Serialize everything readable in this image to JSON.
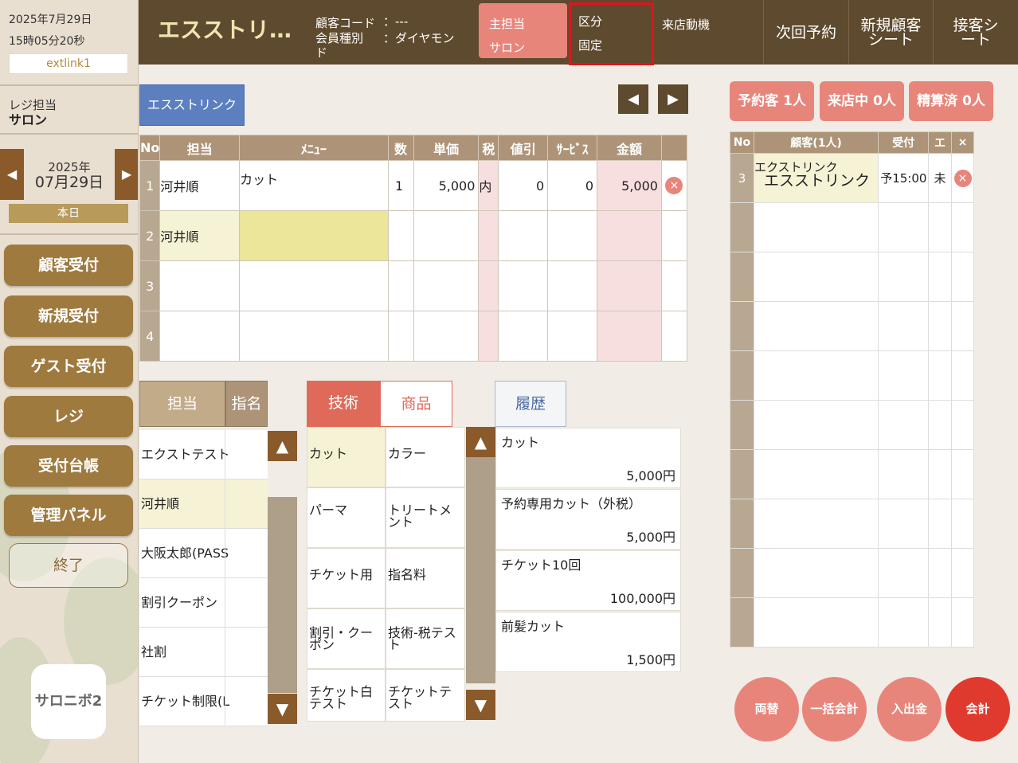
{
  "sidebar": {
    "date": "2025年7月29日",
    "time": "15時05分20秒",
    "link": "extlink1",
    "reji_label": "レジ担当",
    "reji_name": "サロン",
    "cal_year": "2025年",
    "cal_day": "07月29日",
    "prev_icon": "◀",
    "next_icon": "▶",
    "today": "本日",
    "buttons": [
      "顧客受付",
      "新規受付",
      "ゲスト受付",
      "レジ",
      "受付台帳",
      "管理パネル"
    ],
    "end": "終了",
    "logo": "サロニボ2"
  },
  "header": {
    "title": "エスストリ…",
    "customer_code_label": "顧客コード",
    "customer_code_value": "：---",
    "member_type_label": "会員種別",
    "member_type_value": "：ダイヤモン",
    "member_type_wrap": "ド",
    "tanto_label": "主担当",
    "tanto_value": "サロン",
    "kubun_label": "区分",
    "kubun_value": "固定",
    "raiten": "来店動機",
    "nav": [
      "次回予約",
      "新規顧客シート",
      "接客シート"
    ]
  },
  "main": {
    "tab": "エスストリンク",
    "prev": "◀",
    "next": "▶",
    "columns": [
      "No",
      "担当",
      "ﾒﾆｭｰ",
      "数",
      "単価",
      "税",
      "値引",
      "ｻｰﾋﾞｽ",
      "金額"
    ],
    "rows": [
      {
        "no": "1",
        "staff": "河井順",
        "menu": "カット",
        "qty": "1",
        "price": "5,000",
        "tax": "内",
        "discount": "0",
        "service": "0",
        "amount": "5,000",
        "del": "×"
      },
      {
        "no": "2",
        "staff": "河井順",
        "menu": "",
        "qty": "",
        "price": "",
        "tax": "",
        "discount": "",
        "service": "",
        "amount": "",
        "del": ""
      },
      {
        "no": "3",
        "staff": "",
        "menu": "",
        "qty": "",
        "price": "",
        "tax": "",
        "discount": "",
        "service": "",
        "amount": "",
        "del": ""
      },
      {
        "no": "4",
        "staff": "",
        "menu": "",
        "qty": "",
        "price": "",
        "tax": "",
        "discount": "",
        "service": "",
        "amount": "",
        "del": ""
      }
    ]
  },
  "staff_panel": {
    "tab_staff": "担当",
    "tab_shimei": "指名",
    "items": [
      "エクストテスト",
      "河井順",
      "大阪太郎(PASS",
      "割引クーポン",
      "社割",
      "チケット制限(L"
    ],
    "up": "▲",
    "down": "▼"
  },
  "menu_panel": {
    "tab_gijutsu": "技術",
    "tab_shohin": "商品",
    "items": [
      "カット",
      "カラー",
      "パーマ",
      "トリートメント",
      "チケット用",
      "指名料",
      "割引・クーポン",
      "技術-税テスト",
      "チケット白テスト",
      "チケットテスト"
    ],
    "up": "▲",
    "down": "▼"
  },
  "history_panel": {
    "tab": "履歴",
    "items": [
      {
        "name": "カット",
        "price": "5,000円"
      },
      {
        "name": "予約専用カット（外税）",
        "price": "5,000円"
      },
      {
        "name": "チケット10回",
        "price": "100,000円"
      },
      {
        "name": "前髪カット",
        "price": "1,500円"
      }
    ]
  },
  "right": {
    "badges": [
      "予約客 1人",
      "来店中 0人",
      "精算済 0人"
    ],
    "columns": [
      "No",
      "顧客(1人)",
      "受付",
      "エ",
      "×"
    ],
    "row": {
      "no": "3",
      "name_kana": "エクストリンク",
      "name": "エスストリンク",
      "time": "予15:00",
      "status": "未",
      "del": "×"
    },
    "actions": [
      "両替",
      "一括会計",
      "入出金",
      "会計"
    ]
  },
  "colors": {
    "header": "#5e4a2e",
    "accent": "#e8857b",
    "sidebar_button": "#9f7a3f",
    "checkout": "#e03a2e",
    "highlight": "#e0141e"
  }
}
